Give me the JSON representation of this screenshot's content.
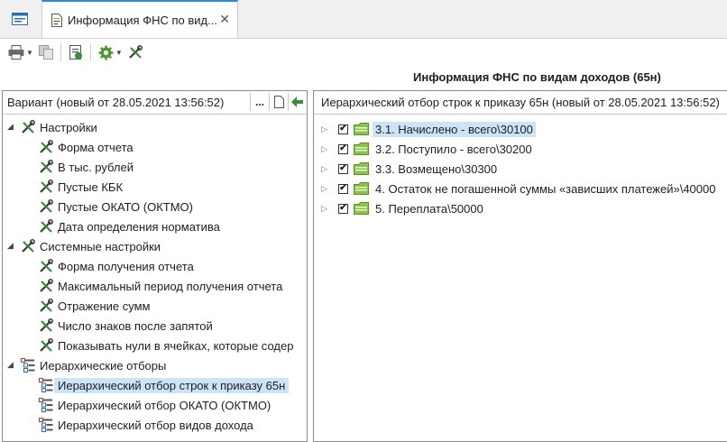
{
  "tab": {
    "title": "Информация ФНС по вид...",
    "close": "✕"
  },
  "report_title": "Информация ФНС по видам доходов (65н)",
  "variant": {
    "text": "Вариант (новый от 28.05.2021 13:56:52)",
    "dots": "..."
  },
  "left_tree": [
    {
      "label": "Настройки",
      "level": 0,
      "icon": "tools-icon",
      "expander": "◢"
    },
    {
      "label": "Форма отчета",
      "level": 1,
      "icon": "tools-icon"
    },
    {
      "label": "В тыс. рублей",
      "level": 1,
      "icon": "tools-icon"
    },
    {
      "label": "Пустые КБК",
      "level": 1,
      "icon": "tools-icon"
    },
    {
      "label": "Пустые ОКАТО (ОКТМО)",
      "level": 1,
      "icon": "tools-icon"
    },
    {
      "label": "Дата определения норматива",
      "level": 1,
      "icon": "tools-icon"
    },
    {
      "label": "Системные настройки",
      "level": 0,
      "icon": "tools-icon",
      "expander": "◢"
    },
    {
      "label": "Форма получения отчета",
      "level": 1,
      "icon": "tools-icon"
    },
    {
      "label": "Максимальный период получения отчета",
      "level": 1,
      "icon": "tools-icon"
    },
    {
      "label": "Отражение сумм",
      "level": 1,
      "icon": "tools-icon"
    },
    {
      "label": "Число знаков после запятой",
      "level": 1,
      "icon": "tools-icon"
    },
    {
      "label": "Показывать нули в ячейках, которые содер",
      "level": 1,
      "icon": "tools-icon"
    },
    {
      "label": "Иерархические отборы",
      "level": 0,
      "icon": "hierarchy-icon",
      "expander": "◢"
    },
    {
      "label": "Иерархический отбор строк к приказу 65н",
      "level": 1,
      "icon": "hierarchy-icon",
      "selected": true
    },
    {
      "label": "Иерархический отбор ОКАТО (ОКТМО)",
      "level": 1,
      "icon": "hierarchy-icon"
    },
    {
      "label": "Иерархический отбор видов дохода",
      "level": 1,
      "icon": "hierarchy-icon"
    }
  ],
  "right_header": "Иерархический отбор строк к приказу 65н (новый от 28.05.2021 13:56:52)",
  "right_tree": [
    {
      "label": "3.1. Начислено - всего\\30100",
      "checked": true,
      "selected": true,
      "icon": "folder-icon"
    },
    {
      "label": "3.2. Поступило - всего\\30200",
      "checked": true,
      "icon": "folder-icon"
    },
    {
      "label": "3.3. Возмещено\\30300",
      "checked": true,
      "icon": "folder-icon"
    },
    {
      "label": "4. Остаток не погашенной суммы «зависших платежей»\\40000",
      "checked": true,
      "icon": "folder-icon"
    },
    {
      "label": "5. Переплата\\50000",
      "checked": true,
      "icon": "folder-icon"
    }
  ],
  "colors": {
    "accent": "#2a8ad4",
    "selection": "#cce4f7",
    "folder": "#8bc34a",
    "tools": "#3a8f3a"
  }
}
